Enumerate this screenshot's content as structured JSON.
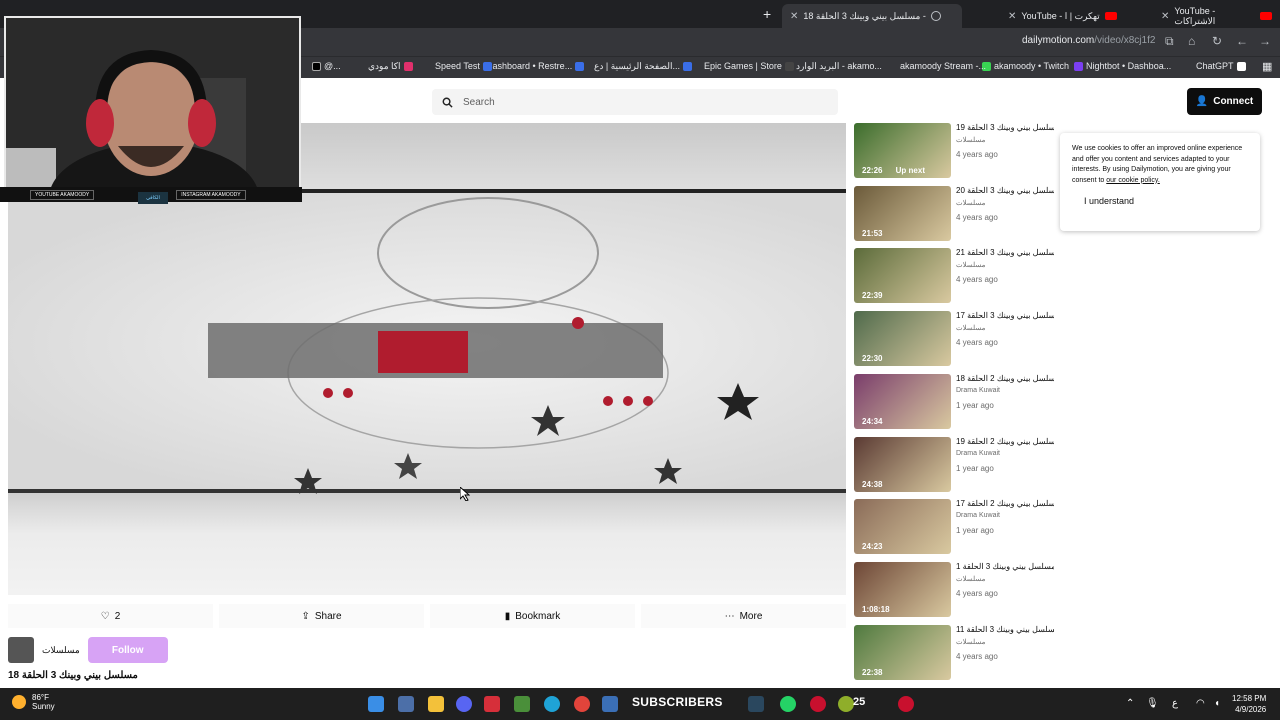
{
  "browser": {
    "tabs": [
      {
        "label": "YouTube - الاشتراكات"
      },
      {
        "label": "YouTube - تهكرت | ا"
      },
      {
        "label": "مسلسل بيني وبينك 3 الحلقة 18 -",
        "active": true
      }
    ],
    "url_domain": "dailymotion.com",
    "url_path": "/video/x8cj1f2",
    "bookmarks": [
      "ChatGPT",
      "Nightbot • Dashboa...",
      "akamoody • Twitch",
      "akamoody Stream -...",
      "البريد الوارد - akamo...",
      "Epic Games | Store",
      "الصفحة الرئيسية | دع...",
      "Dashboard • Restre...",
      "Speed Test",
      "اكا مودي",
      "@..."
    ]
  },
  "header": {
    "search_placeholder": "Search",
    "connect_label": "Connect"
  },
  "actions": {
    "like_count": "2",
    "share_label": "Share",
    "bookmark_label": "Bookmark",
    "more_label": "More"
  },
  "channel": {
    "name": "مسلسلات",
    "follow_label": "Follow"
  },
  "video_title": "مسلسل بيني وبينك 3 الحلقة 18",
  "related": [
    {
      "title": "مسلسل بيني وبينك 3 الحلقة 19",
      "channel": "مسلسلات",
      "age": "4 years ago",
      "duration": "22:26",
      "badge": "Up next",
      "thumb": "#3b6d2c"
    },
    {
      "title": "مسلسل بيني وبينك 3 الحلقة 20",
      "channel": "مسلسلات",
      "age": "4 years ago",
      "duration": "21:53",
      "thumb": "#6b5a3a"
    },
    {
      "title": "مسلسل بيني وبينك 3 الحلقة 21",
      "channel": "مسلسلات",
      "age": "4 years ago",
      "duration": "22:39",
      "thumb": "#5b6b3a"
    },
    {
      "title": "مسلسل بيني وبينك 3 الحلقة 17",
      "channel": "مسلسلات",
      "age": "4 years ago",
      "duration": "22:30",
      "thumb": "#4f6a4b"
    },
    {
      "title": "مسلسل بيني وبينك 2 الحلقة 18",
      "channel": "Drama Kuwait",
      "age": "1 year ago",
      "duration": "24:34",
      "thumb": "#7a3d6b"
    },
    {
      "title": "مسلسل بيني وبينك 2 الحلقة 19",
      "channel": "Drama Kuwait",
      "age": "1 year ago",
      "duration": "24:38",
      "thumb": "#5a3a33"
    },
    {
      "title": "مسلسل بيني وبينك 2 الحلقة 17",
      "channel": "Drama Kuwait",
      "age": "1 year ago",
      "duration": "24:23",
      "thumb": "#8a6b58"
    },
    {
      "title": "مسلسل بيني وبينك 3 الحلقة 1",
      "channel": "مسلسلات",
      "age": "4 years ago",
      "duration": "1:08:18",
      "thumb": "#6d4636"
    },
    {
      "title": "مسلسل بيني وبينك 3 الحلقة 11",
      "channel": "مسلسلات",
      "age": "4 years ago",
      "duration": "22:38",
      "thumb": "#4f7a3f"
    }
  ],
  "cookie_banner": {
    "text": "We use cookies to offer an improved online experience and offer you content and services adapted to your interests. By using Dailymotion, you are giving your consent to",
    "link": "our cookie policy.",
    "button": "I understand"
  },
  "webcam": {
    "bar_left": "YOUTUBE AKAMOODY",
    "bar_mid": "الكافي",
    "bar_right": "INSTAGRAM AKAMOODY"
  },
  "taskbar": {
    "weather_temp": "86°F",
    "weather_cond": "Sunny",
    "subscribers_label": "SUBSCRIBERS",
    "subscribers_count": "25",
    "lang": "ع",
    "time": "12:58 PM",
    "date": "4/9/2026"
  }
}
